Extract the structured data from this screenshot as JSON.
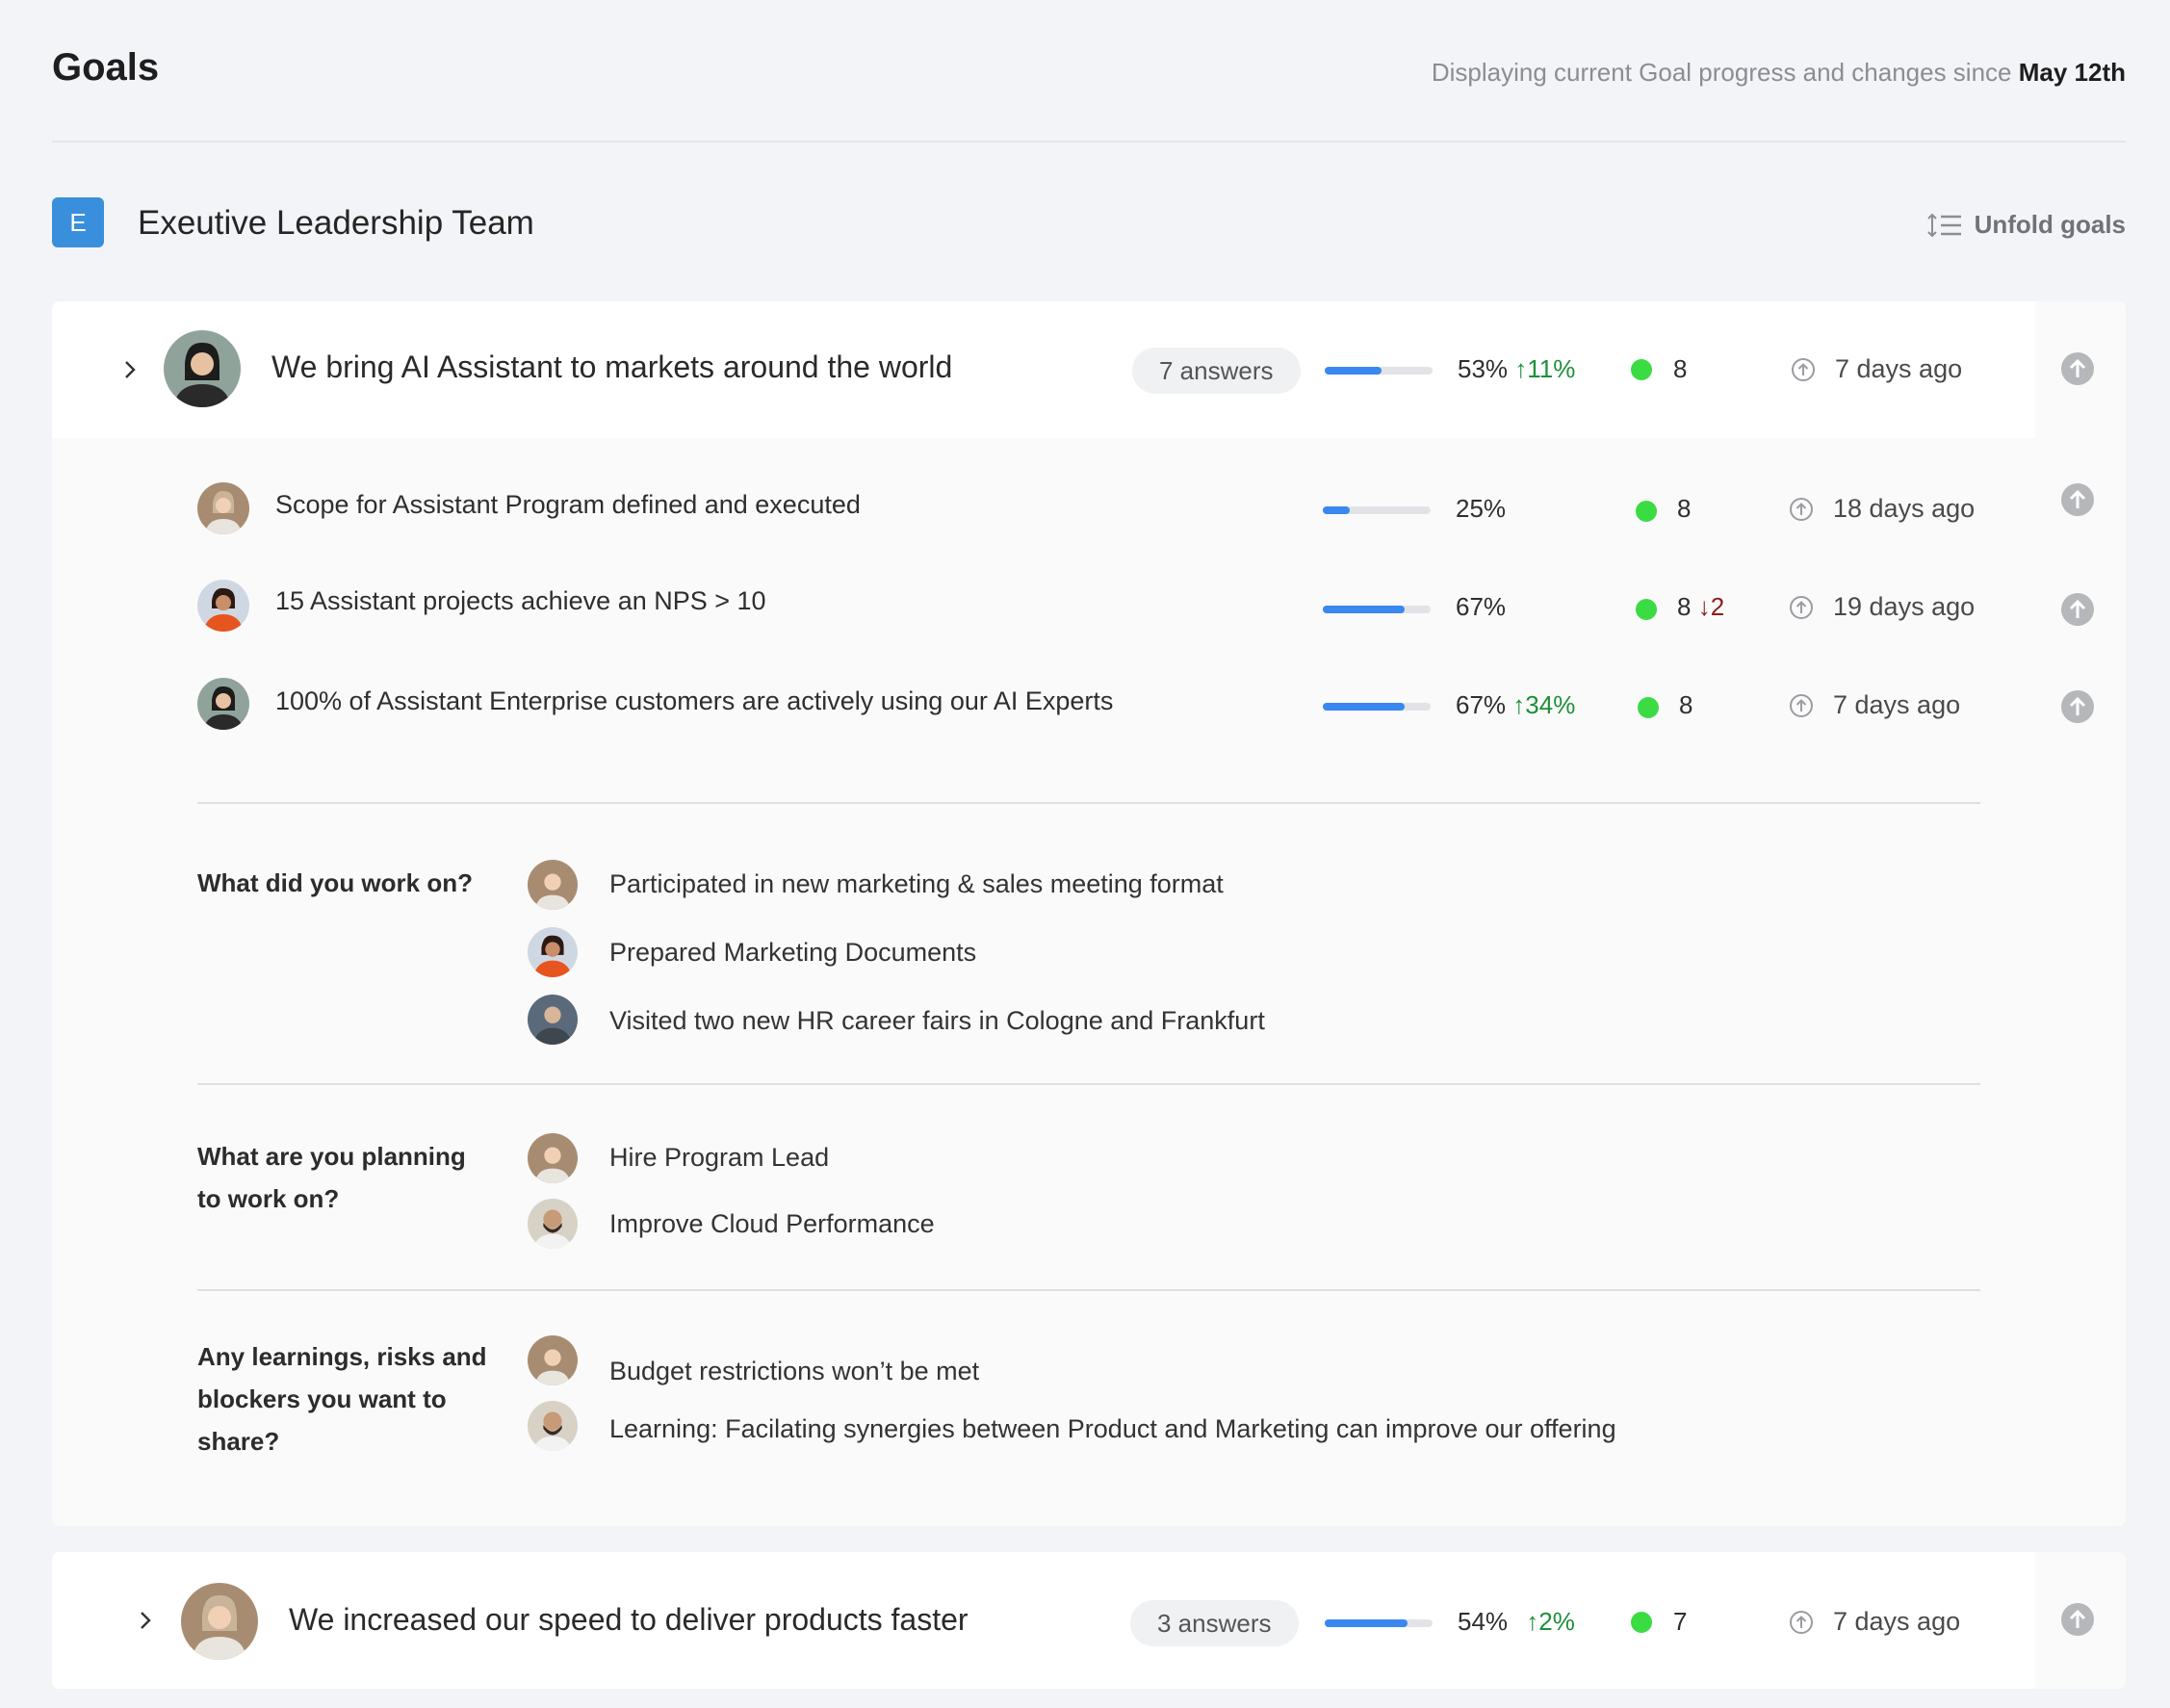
{
  "header": {
    "title": "Goals",
    "since_text": "Displaying current Goal progress and changes since ",
    "since_date": "May 12th"
  },
  "team": {
    "badge": "E",
    "name": "Exeutive Leadership Team",
    "unfold_label": "Unfold goals"
  },
  "goals": [
    {
      "title": "We bring AI Assistant to markets around the world",
      "answers_label": "7 answers",
      "progress": 0.53,
      "percent": "53%",
      "delta": "11%",
      "delta_dir": "up",
      "count": "8",
      "updated": "7 days ago",
      "subgoals": [
        {
          "title": "Scope for Assistant Program defined and executed",
          "progress": 0.25,
          "percent": "25%",
          "delta": "",
          "count": "8",
          "count_delta": "",
          "updated": "18 days ago"
        },
        {
          "title": "15 Assistant projects achieve an NPS > 10",
          "progress": 0.67,
          "percent": "67%",
          "delta": "",
          "count": "8",
          "count_delta": "2",
          "updated": "19 days ago"
        },
        {
          "title": "100% of Assistant Enterprise customers are actively using our AI Experts",
          "progress": 0.67,
          "percent": "67%",
          "delta": "34%",
          "count": "8",
          "count_delta": "",
          "updated": "7 days ago"
        }
      ],
      "questions": [
        {
          "label": "What did you work on?",
          "answers": [
            "Participated in new marketing & sales meeting format",
            "Prepared Marketing Documents",
            "Visited two new HR career fairs in Cologne and Frankfurt"
          ]
        },
        {
          "label": "What are you planning to work on?",
          "answers": [
            "Hire Program Lead",
            "Improve Cloud Performance"
          ]
        },
        {
          "label": "Any learnings, risks and blockers you want to share?",
          "answers": [
            "Budget restrictions won’t be met",
            "Learning: Facilating synergies between Product and Marketing can improve our offering"
          ]
        }
      ]
    },
    {
      "title": "We increased our speed to deliver products faster",
      "answers_label": "3 answers",
      "progress": 0.54,
      "percent": "54%",
      "delta": "2%",
      "delta_dir": "up",
      "count": "7",
      "updated": "7 days ago"
    }
  ],
  "colors": {
    "accent": "#3a87f0",
    "status_green": "#3bdb44",
    "delta_up": "#1e8f3a",
    "delta_down": "#8b1d1d",
    "badge": "#3a8fdc"
  },
  "icons": {
    "chevron": "chevron-right-icon",
    "update": "arrow-up-circle-icon",
    "action": "upload-circle-icon",
    "unfold": "sort-list-icon"
  }
}
